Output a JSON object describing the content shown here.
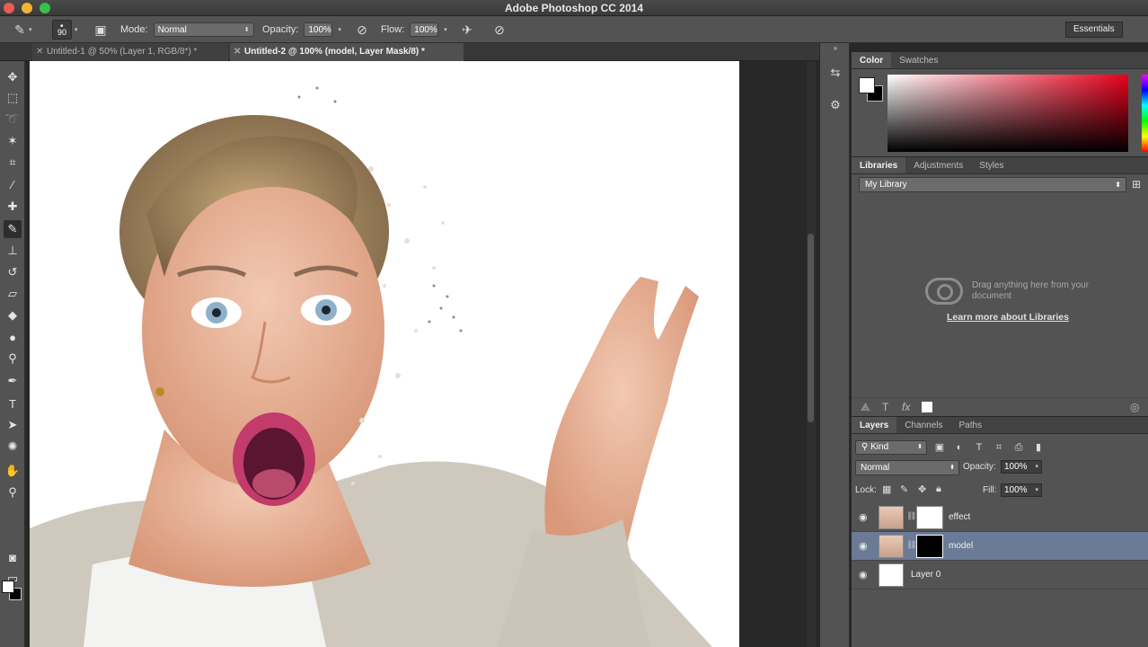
{
  "window": {
    "title": "Adobe Photoshop CC 2014"
  },
  "options_bar": {
    "brush_size": "90",
    "mode_label": "Mode:",
    "mode_value": "Normal",
    "opacity_label": "Opacity:",
    "opacity_value": "100%",
    "flow_label": "Flow:",
    "flow_value": "100%",
    "workspace": "Essentials"
  },
  "doc_tabs": [
    {
      "label": "Untitled-1 @ 50% (Layer 1, RGB/8*) *",
      "active": false
    },
    {
      "label": "Untitled-2 @ 100% (model, Layer Mask/8) *",
      "active": true
    }
  ],
  "color_panel": {
    "tabs": [
      "Color",
      "Swatches"
    ],
    "foreground": "#ffffff",
    "background": "#000000"
  },
  "libraries_panel": {
    "tabs": [
      "Libraries",
      "Adjustments",
      "Styles"
    ],
    "library_name": "My Library",
    "empty_message": "Drag anything here from your document",
    "learn_link": "Learn more about Libraries"
  },
  "layers_panel": {
    "tabs": [
      "Layers",
      "Channels",
      "Paths"
    ],
    "filter_kind": "Kind",
    "blend_mode": "Normal",
    "opacity_label": "Opacity:",
    "opacity_value": "100%",
    "lock_label": "Lock:",
    "fill_label": "Fill:",
    "fill_value": "100%",
    "layers": [
      {
        "name": "effect",
        "selected": false,
        "has_mask": true
      },
      {
        "name": "model",
        "selected": true,
        "has_mask": true
      },
      {
        "name": "Layer 0",
        "selected": false,
        "has_mask": false
      }
    ]
  },
  "colors": {
    "selected_layer": "#6b7a96",
    "panel_bg": "#535353",
    "canvas_bg": "#ffffff"
  }
}
